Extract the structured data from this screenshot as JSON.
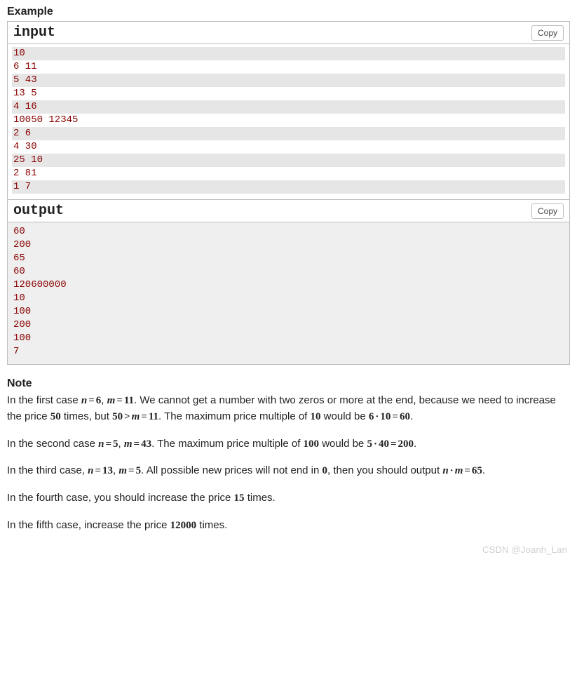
{
  "example_heading": "Example",
  "input_block": {
    "title": "input",
    "copy_label": "Copy",
    "lines": [
      "10",
      "6 11",
      "5 43",
      "13 5",
      "4 16",
      "10050 12345",
      "2 6",
      "4 30",
      "25 10",
      "2 81",
      "1 7"
    ]
  },
  "output_block": {
    "title": "output",
    "copy_label": "Copy",
    "lines": [
      "60",
      "200",
      "65",
      "60",
      "120600000",
      "10",
      "100",
      "200",
      "100",
      "7"
    ]
  },
  "note": {
    "heading": "Note",
    "p1": {
      "t1": "In the first case ",
      "eq1_var_n": "n",
      "eq1_eq": "=",
      "eq1_val_n": "6",
      "comma": ", ",
      "eq1_var_m": "m",
      "eq1_val_m": "11",
      "t2": ". We cannot get a number with two zeros or more at the end, because we need to increase the price ",
      "fifty": "50",
      "t3": " times, but ",
      "fifty2": "50",
      "gt": ">",
      "mvar": "m",
      "eq2": "=",
      "eleven": "11",
      "t4": ". The maximum price multiple of ",
      "ten": "10",
      "t5": " would be ",
      "six": "6",
      "dot": "·",
      "ten2": "10",
      "eq3": "=",
      "sixty": "60",
      "period": "."
    },
    "p2": {
      "t1": "In the second case ",
      "n": "n",
      "eq": "=",
      "nv": "5",
      "comma": ", ",
      "m": "m",
      "mv": "43",
      "t2": ". The maximum price multiple of ",
      "hundred": "100",
      "t3": " would be ",
      "five": "5",
      "dot": "·",
      "forty": "40",
      "eq2": "=",
      "twoh": "200",
      "period": "."
    },
    "p3": {
      "t1": "In the third case, ",
      "n": "n",
      "eq": "=",
      "nv": "13",
      "comma": ", ",
      "m": "m",
      "mv": "5",
      "t2": ". All possible new prices will not end in ",
      "zero": "0",
      "t3": ", then you should output ",
      "n2": "n",
      "dot": "·",
      "m2": "m",
      "eq2": "=",
      "sixtyfive": "65",
      "period": "."
    },
    "p4": {
      "t1": "In the fourth case, you should increase the price ",
      "fifteen": "15",
      "t2": " times."
    },
    "p5": {
      "t1": "In the fifth case, increase the price ",
      "twelve_k": "12000",
      "t2": " times."
    }
  },
  "watermark": "CSDN @Joanh_Lan"
}
